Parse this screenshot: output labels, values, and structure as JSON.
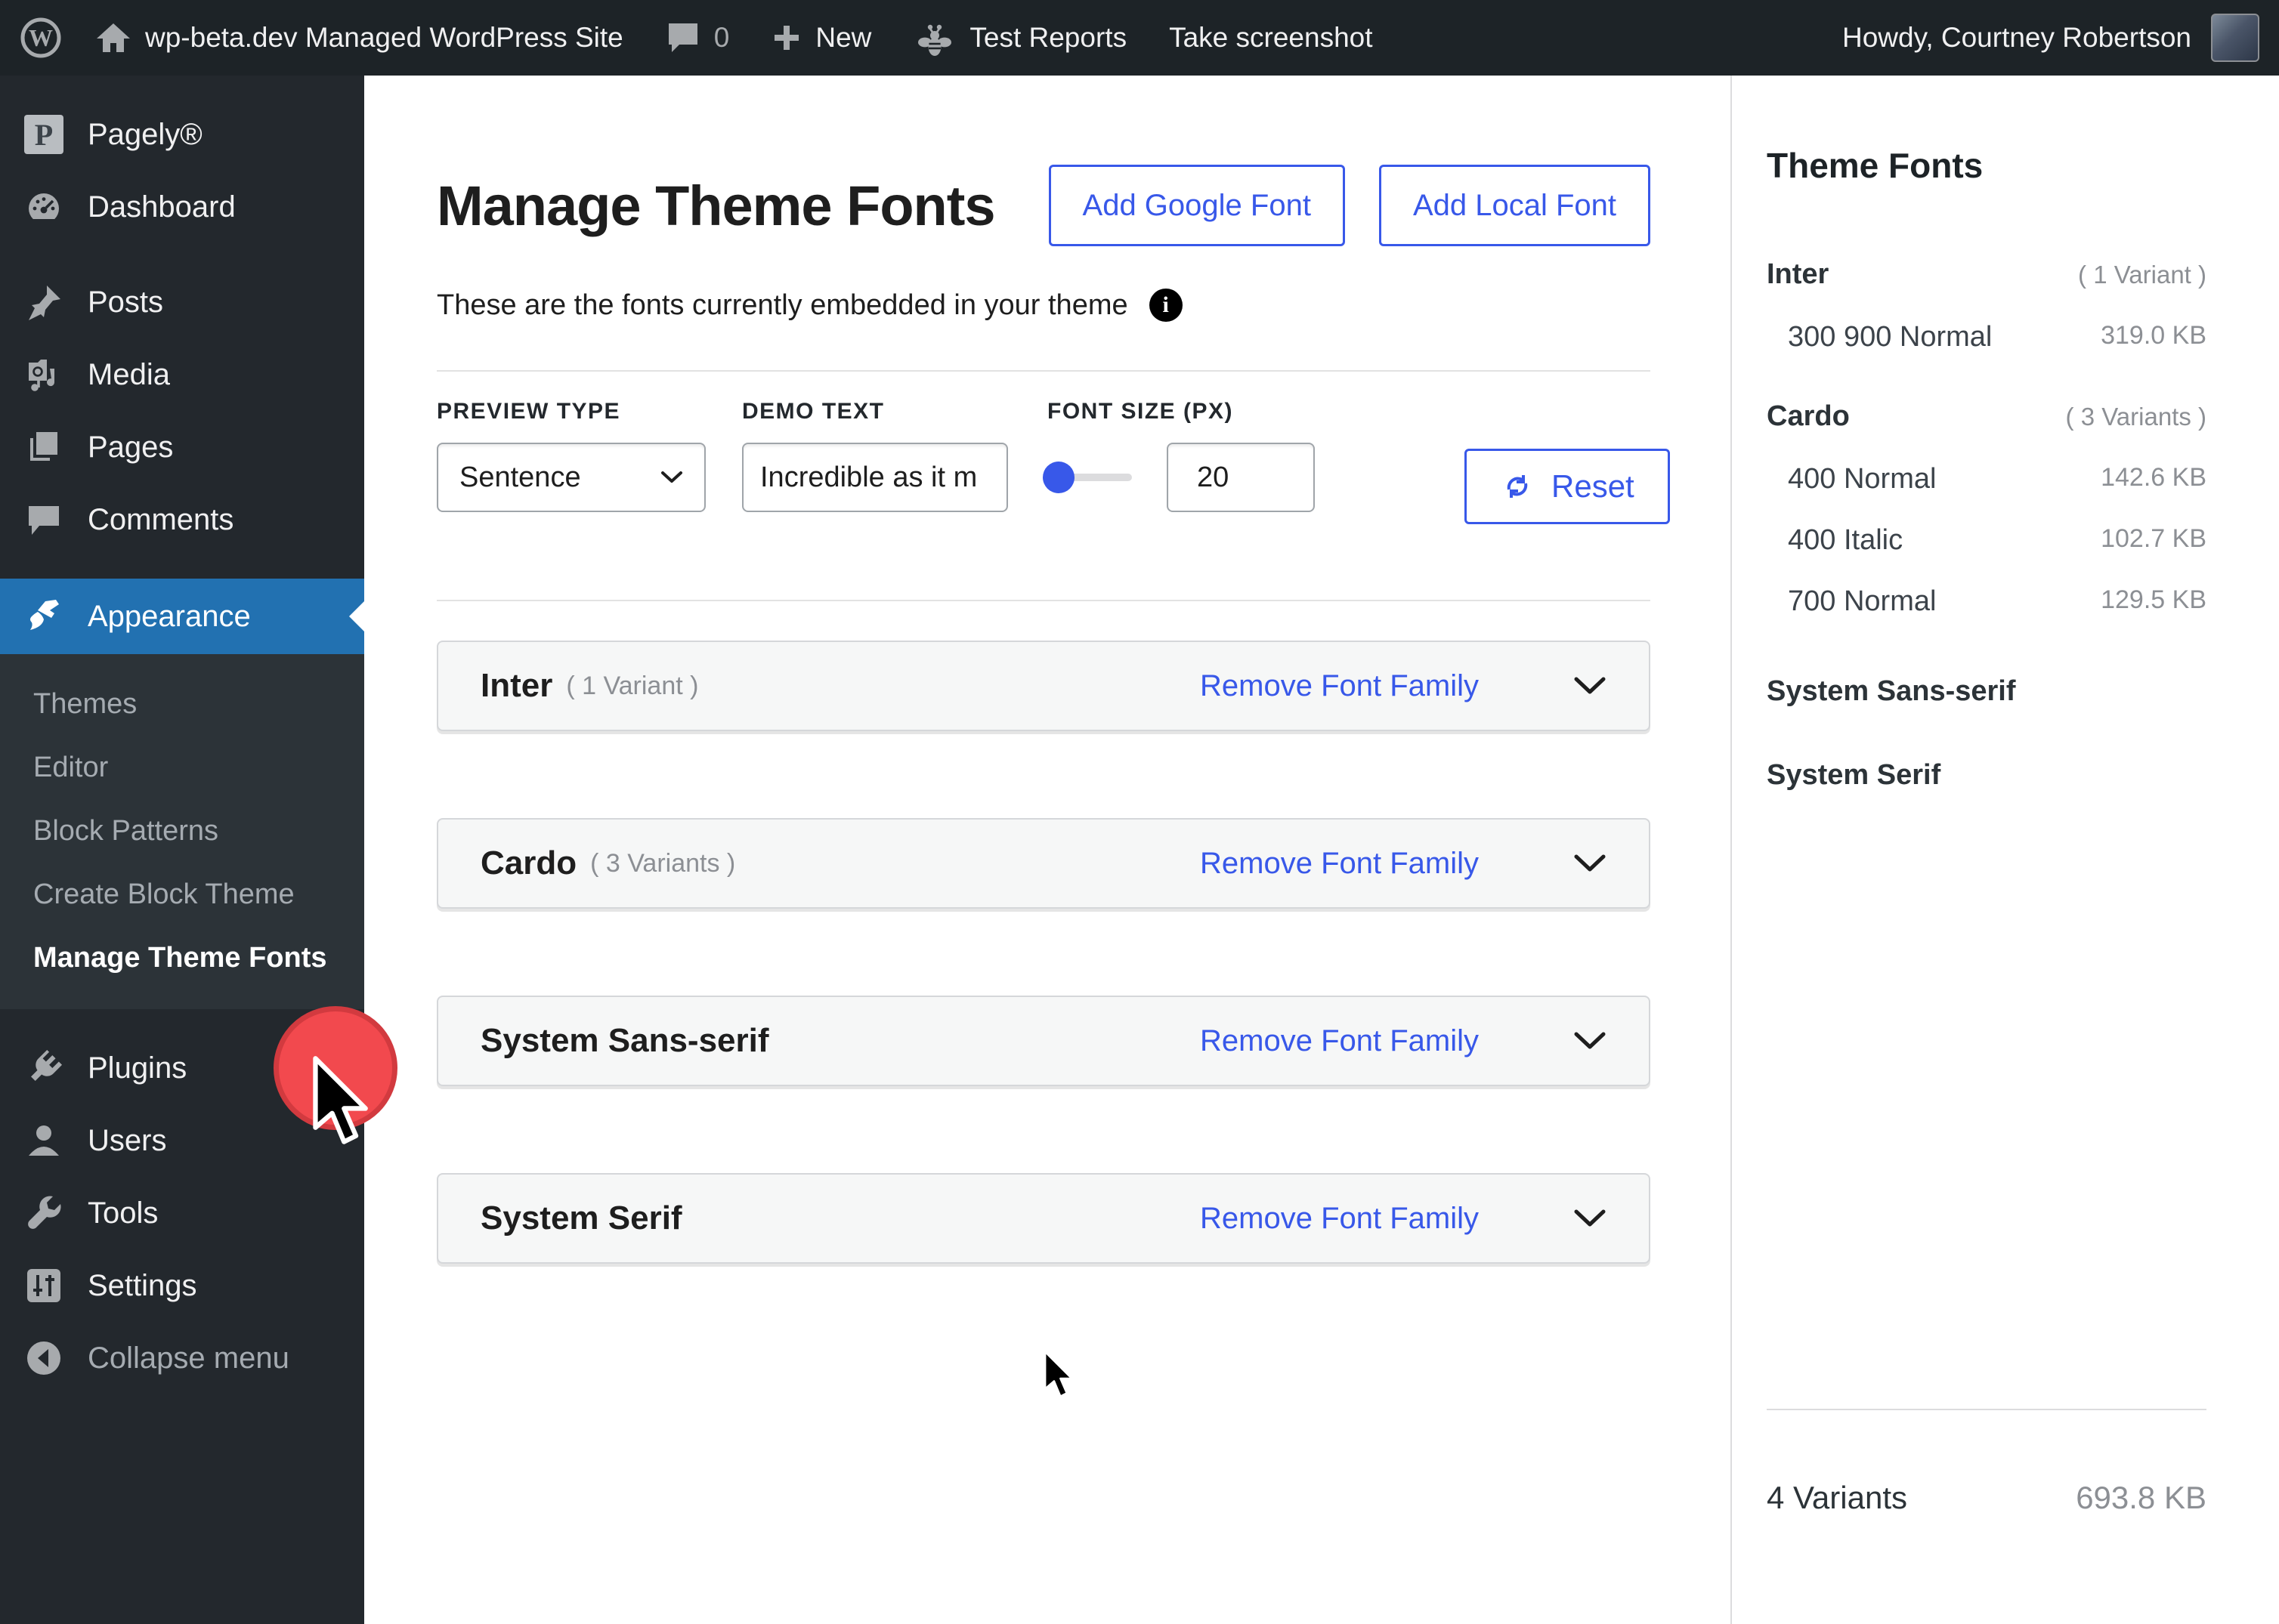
{
  "admin_bar": {
    "site_name": "wp-beta.dev Managed WordPress Site",
    "comments_count": "0",
    "new_label": "New",
    "test_reports_label": "Test Reports",
    "take_screenshot_label": "Take screenshot",
    "howdy": "Howdy, Courtney Robertson"
  },
  "sidebar": {
    "menu": [
      {
        "label": "Pagely®"
      },
      {
        "label": "Dashboard"
      },
      {
        "label": "Posts"
      },
      {
        "label": "Media"
      },
      {
        "label": "Pages"
      },
      {
        "label": "Comments"
      },
      {
        "label": "Appearance"
      },
      {
        "label": "Plugins"
      },
      {
        "label": "Users"
      },
      {
        "label": "Tools"
      },
      {
        "label": "Settings"
      },
      {
        "label": "Collapse menu"
      }
    ],
    "appearance_submenu": [
      {
        "label": "Themes"
      },
      {
        "label": "Editor"
      },
      {
        "label": "Block Patterns"
      },
      {
        "label": "Create Block Theme"
      },
      {
        "label": "Manage Theme Fonts"
      }
    ],
    "active_item": "Appearance",
    "active_submenu_item": "Manage Theme Fonts"
  },
  "main": {
    "title": "Manage Theme Fonts",
    "add_google_font_label": "Add Google Font",
    "add_local_font_label": "Add Local Font",
    "subtitle": "These are the fonts currently embedded in your theme",
    "info_icon_glyph": "i",
    "controls": {
      "preview_type_label": "PREVIEW TYPE",
      "preview_type_value": "Sentence",
      "demo_text_label": "DEMO TEXT",
      "demo_text_value": "Incredible as it m",
      "font_size_label": "FONT SIZE (PX)",
      "font_size_value": "20",
      "reset_label": "Reset"
    },
    "font_rows": [
      {
        "name": "Inter",
        "variants": "( 1 Variant )",
        "action": "Remove Font Family"
      },
      {
        "name": "Cardo",
        "variants": "( 3 Variants )",
        "action": "Remove Font Family"
      },
      {
        "name": "System Sans-serif",
        "variants": "",
        "action": "Remove Font Family"
      },
      {
        "name": "System Serif",
        "variants": "",
        "action": "Remove Font Family"
      }
    ]
  },
  "right_panel": {
    "title": "Theme Fonts",
    "groups": [
      {
        "name": "Inter",
        "count": "( 1 Variant )",
        "variants": [
          {
            "label": "300 900 Normal",
            "size": "319.0 KB"
          }
        ]
      },
      {
        "name": "Cardo",
        "count": "( 3 Variants )",
        "variants": [
          {
            "label": "400 Normal",
            "size": "142.6 KB"
          },
          {
            "label": "400 Italic",
            "size": "102.7 KB"
          },
          {
            "label": "700 Normal",
            "size": "129.5 KB"
          }
        ]
      },
      {
        "name": "System Sans-serif",
        "count": "",
        "variants": []
      },
      {
        "name": "System Serif",
        "count": "",
        "variants": []
      }
    ],
    "total_label": "4 Variants",
    "total_size": "693.8 KB"
  },
  "icons": {
    "wordpress-logo-icon": "W in circle",
    "home-icon": "house",
    "comments-bubble-icon": "speech bubble",
    "plus-icon": "plus",
    "bee-icon": "bee",
    "pagely-logo": "P square",
    "dashboard-icon": "gauge",
    "posts-icon": "pushpin",
    "media-icon": "camera with note",
    "pages-icon": "stacked pages",
    "appearance-icon": "paintbrush",
    "plugins-icon": "plug",
    "users-icon": "person",
    "tools-icon": "wrench",
    "settings-icon": "sliders",
    "collapse-icon": "circled left arrow",
    "chevron-down-icon": "v chevron",
    "info-icon": "filled info dot",
    "reset-icon": "circular update arrows",
    "cursor-icon": "mouse pointer arrow"
  },
  "colors": {
    "admin_bar_bg": "#1d2327",
    "sidebar_bg": "#23282d",
    "submenu_bg": "#2c3338",
    "active_menu_bg": "#2271b1",
    "accent_blue": "#3858e9",
    "row_bg": "#f6f7f7",
    "muted_gray": "#8c8f94",
    "click_indicator_red": "#f2494e"
  }
}
